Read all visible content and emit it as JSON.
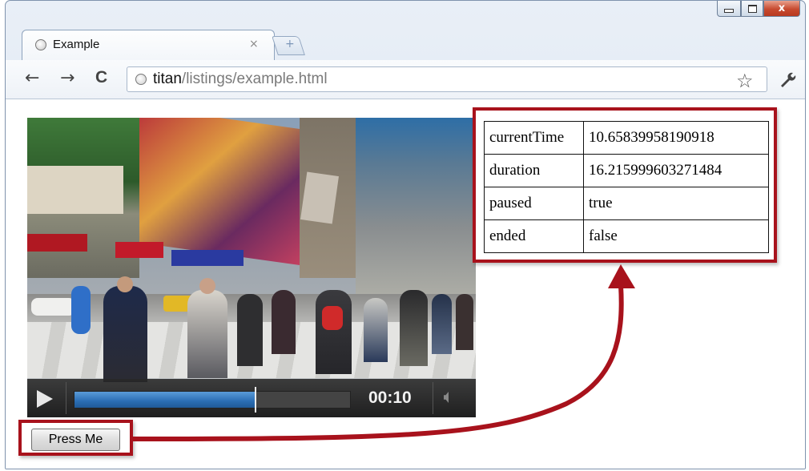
{
  "window": {
    "minimize_icon": "minimize-icon",
    "maximize_icon": "maximize-icon",
    "close_glyph": "x"
  },
  "tab": {
    "title": "Example",
    "close_glyph": "×",
    "new_tab_glyph": "+"
  },
  "toolbar": {
    "back_glyph": "←",
    "forward_glyph": "→",
    "reload_glyph": "C",
    "url_host": "titan",
    "url_path": "/listings/example.html",
    "star_glyph": "☆",
    "wrench_glyph": "🔧"
  },
  "video": {
    "progress_fraction": 0.657,
    "time": "00:10",
    "description_icon": "play-icon"
  },
  "properties": {
    "rows": [
      {
        "key": "currentTime",
        "value": "10.65839958190918"
      },
      {
        "key": "duration",
        "value": "16.215999603271484"
      },
      {
        "key": "paused",
        "value": "true"
      },
      {
        "key": "ended",
        "value": "false"
      }
    ]
  },
  "button": {
    "label": "Press Me"
  },
  "colors": {
    "annotation_red": "#a8121c",
    "progress_blue": "#2a6db3"
  }
}
